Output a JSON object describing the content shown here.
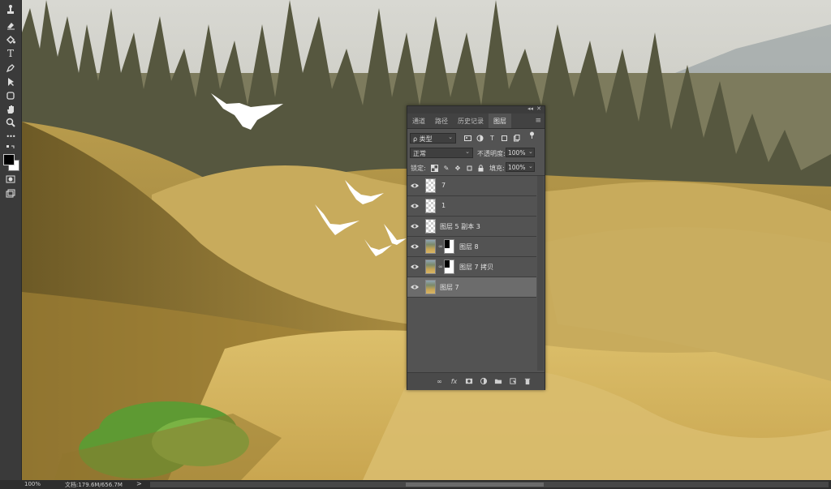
{
  "toolbar": {
    "tools": [
      {
        "name": "stamp-tool-icon"
      },
      {
        "name": "eraser-tool-icon"
      },
      {
        "name": "paint-bucket-icon"
      },
      {
        "name": "pen-tool-icon"
      },
      {
        "name": "type-tool-icon"
      },
      {
        "name": "pen-tool-2-icon"
      },
      {
        "name": "path-select-icon"
      },
      {
        "name": "rectangle-tool-icon"
      },
      {
        "name": "hand-tool-icon"
      },
      {
        "name": "zoom-tool-icon"
      },
      {
        "name": "more-tools-icon"
      },
      {
        "name": "swap-colors-icon"
      },
      {
        "name": "quick-mask-icon"
      },
      {
        "name": "screen-mode-icon"
      }
    ],
    "type_glyph": "T",
    "more_glyph": "•••",
    "foreground_color": "#000000",
    "background_color": "#ffffff"
  },
  "canvas": {
    "description_colors": {
      "sky": "#c9c9c4",
      "hills": "#c4a550",
      "shadow": "#7a6428",
      "grass": "#6aa33a"
    }
  },
  "statusbar": {
    "zoom": "100%",
    "doc_info": "文档:179.6M/656.7M",
    "arrow": ">"
  },
  "panel": {
    "tabs": [
      "通道",
      "路径",
      "历史记录",
      "图层"
    ],
    "active_tab": "图层",
    "menu_glyph": "≡",
    "collapse_glyph": "◂◂",
    "close_glyph": "✕",
    "filter": {
      "label": "ρ 类型",
      "dropdown": "⌄"
    },
    "blend_mode": "正常",
    "opacity_label": "不透明度:",
    "opacity_value": "100%",
    "lock_label": "锁定:",
    "fill_label": "填充:",
    "fill_value": "100%",
    "layers": [
      {
        "name": "7",
        "thumb": "transparent",
        "mask": false,
        "selected": false
      },
      {
        "name": "1",
        "thumb": "transparent",
        "mask": false,
        "selected": false
      },
      {
        "name": "图层 5 副本 3",
        "thumb": "transparent",
        "mask": false,
        "selected": false
      },
      {
        "name": "图层 8",
        "thumb": "image",
        "mask": true,
        "selected": false
      },
      {
        "name": "图层 7 拷贝",
        "thumb": "image",
        "mask": true,
        "selected": false
      },
      {
        "name": "图层 7",
        "thumb": "image",
        "mask": false,
        "selected": true
      }
    ],
    "bottom_icons": [
      "link-layers-icon",
      "fx-icon",
      "add-mask-icon",
      "adjustment-layer-icon",
      "new-group-icon",
      "new-layer-icon",
      "delete-layer-icon"
    ],
    "fx_glyph": "fx"
  }
}
